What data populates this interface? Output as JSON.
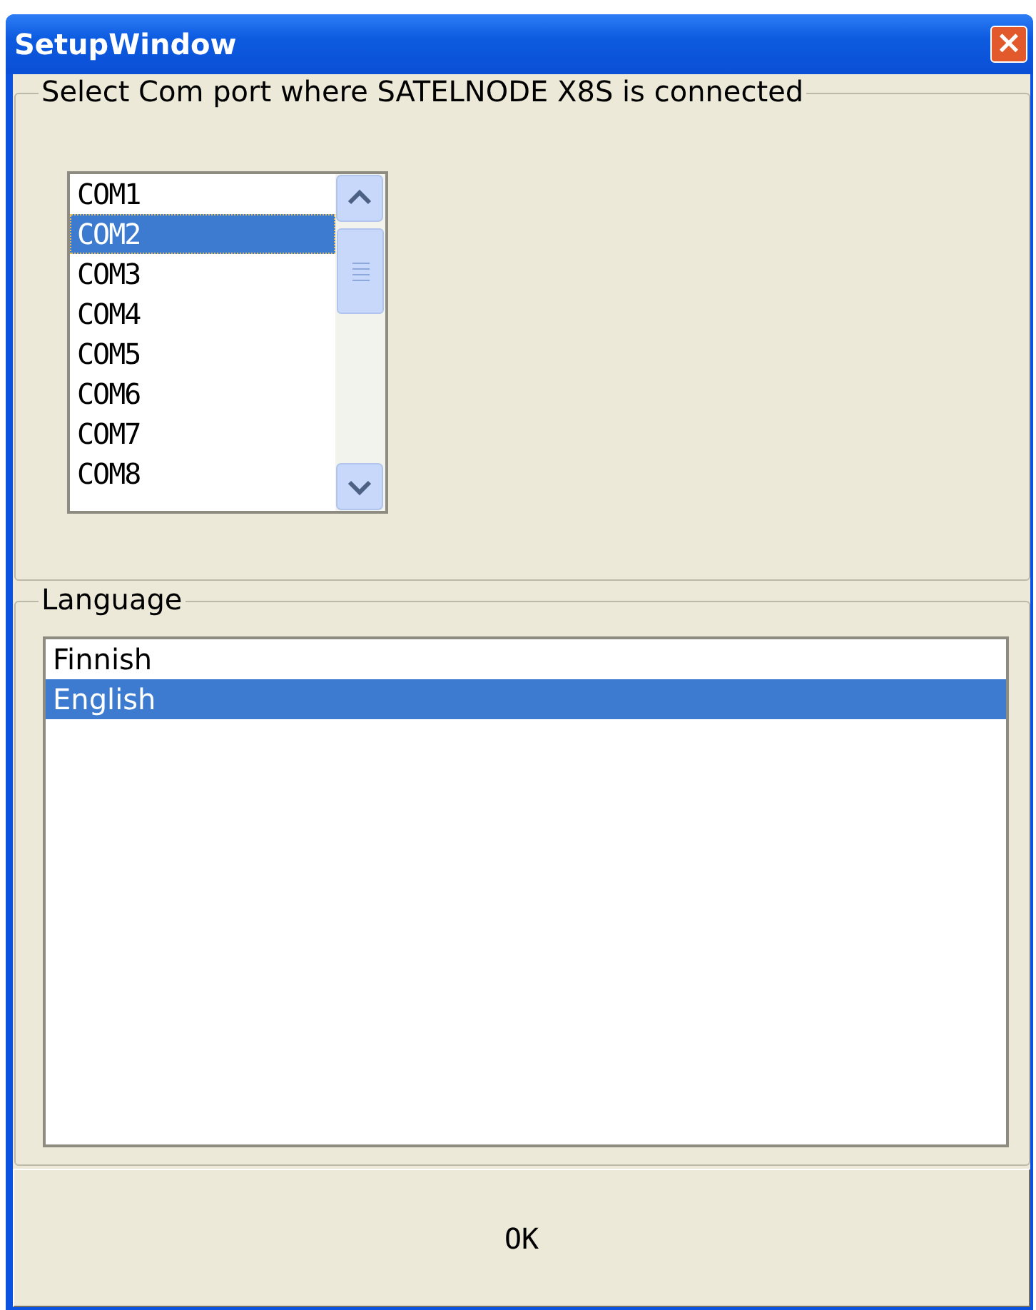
{
  "window": {
    "title": "SetupWindow",
    "close": "×"
  },
  "com_port": {
    "label": "Select Com port where SATELNODE X8S is connected",
    "items": [
      {
        "label": "COM1",
        "selected": false
      },
      {
        "label": "COM2",
        "selected": true
      },
      {
        "label": "COM3",
        "selected": false
      },
      {
        "label": "COM4",
        "selected": false
      },
      {
        "label": "COM5",
        "selected": false
      },
      {
        "label": "COM6",
        "selected": false
      },
      {
        "label": "COM7",
        "selected": false
      },
      {
        "label": "COM8",
        "selected": false
      }
    ]
  },
  "language": {
    "label": "Language",
    "items": [
      {
        "label": "Finnish",
        "selected": false
      },
      {
        "label": "English",
        "selected": true
      }
    ]
  },
  "buttons": [
    "OK"
  ]
}
